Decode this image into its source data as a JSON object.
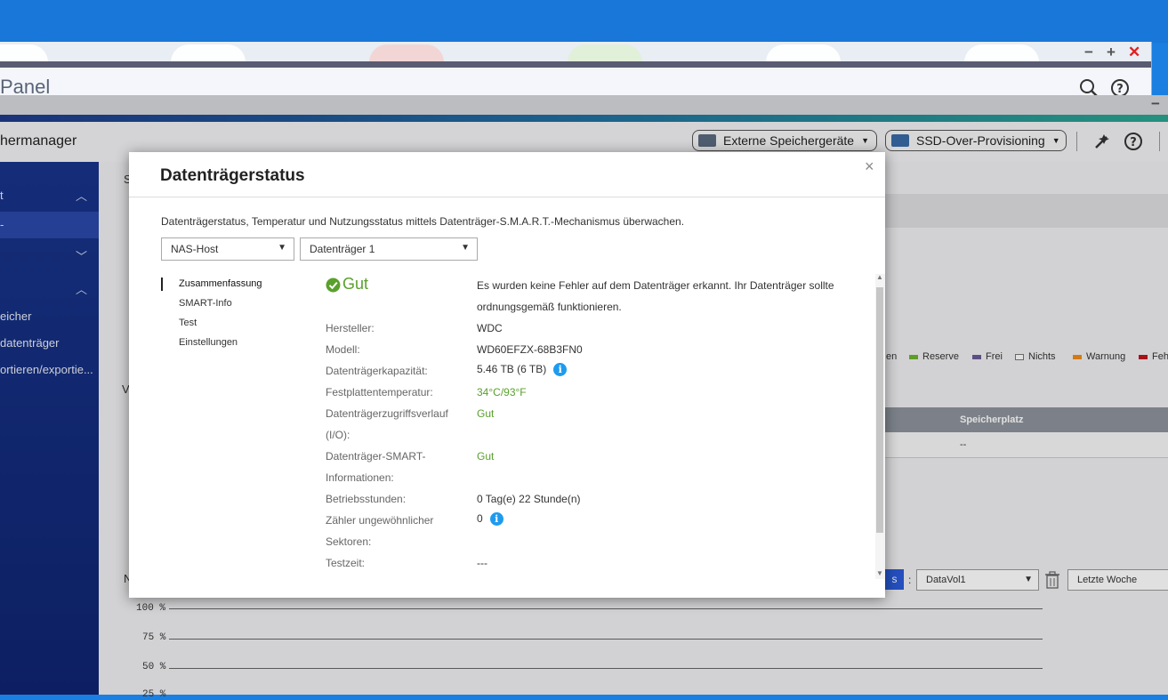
{
  "control_panel": {
    "title": "Panel",
    "win_minimize": "−",
    "win_maximize": "+",
    "win_close": "✕"
  },
  "storage_manager": {
    "title": "hermanager",
    "external_button": "Externe Speichergeräte",
    "ssd_button": "SSD-Over-Provisioning",
    "sidebar": [
      {
        "label": "t",
        "state": "expanded"
      },
      {
        "label": "-",
        "state": "selected"
      },
      {
        "label": "",
        "state": "collapsed"
      },
      {
        "label": "",
        "state": "expanded"
      },
      {
        "label": "eicher"
      },
      {
        "label": "datenträger"
      },
      {
        "label": "ortieren/exportie..."
      }
    ],
    "legend": [
      {
        "label": "en",
        "color": "#4a4a4a"
      },
      {
        "label": "Reserve",
        "color": "#6ab42d"
      },
      {
        "label": "Frei",
        "color": "#6a5a98"
      },
      {
        "label": "Nichts",
        "color": "#ffffff"
      },
      {
        "label": "Warnung",
        "color": "#f08c1a"
      },
      {
        "label": "Feh",
        "color": "#c0141e"
      }
    ],
    "table_header": "Speicherplatz",
    "table_cell": "--",
    "volume_select": "DataVol1",
    "range_select": "Letzte Woche",
    "chart_ticks": [
      "100 %",
      "75 %",
      "50 %",
      "25 %"
    ],
    "bg_letter_1": "S",
    "bg_letter_2": "V",
    "bg_letter_3": "N",
    "blue_btn": "s",
    "colon": ":"
  },
  "dialog": {
    "title": "Datenträgerstatus",
    "close": "×",
    "description": "Datenträgerstatus, Temperatur und Nutzungsstatus mittels Datenträger-S.M.A.R.T.-Mechanismus überwachen.",
    "host_select": "NAS-Host",
    "disk_select": "Datenträger 1",
    "nav": [
      "Zusammenfassung",
      "SMART-Info",
      "Test",
      "Einstellungen"
    ],
    "status": "Gut",
    "status_message_1": "Es wurden keine Fehler auf dem Datenträger erkannt. Ihr Datenträger sollte",
    "status_message_2": "ordnungsgemäß funktionieren.",
    "fields": {
      "manufacturer_label": "Hersteller:",
      "manufacturer": "WDC",
      "model_label": "Modell:",
      "model": "WD60EFZX-68B3FN0",
      "capacity_label": "Datenträgerkapazität:",
      "capacity": "5.46 TB (6 TB)",
      "temp_label": "Festplattentemperatur:",
      "temp": "34°C/93°F",
      "io_label_1": "Datenträgerzugriffsverlauf",
      "io_label_2": "(I/O):",
      "io": "Gut",
      "smart_label_1": "Datenträger-SMART-",
      "smart_label_2": "Informationen:",
      "smart": "Gut",
      "hours_label": "Betriebsstunden:",
      "hours": "0 Tag(e) 22 Stunde(n)",
      "sectors_label_1": "Zähler ungewöhnlicher",
      "sectors_label_2": "Sektoren:",
      "sectors": "0",
      "testtime_label": "Testzeit:",
      "testtime": "---"
    }
  }
}
